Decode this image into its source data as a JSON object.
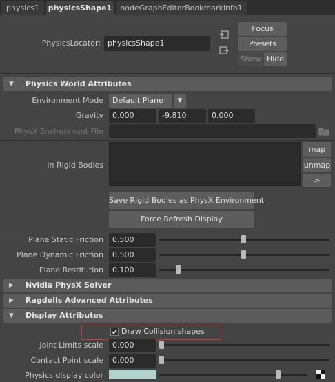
{
  "tabs": [
    "physics1",
    "physicsShape1",
    "nodeGraphEditorBookmarkInfo1"
  ],
  "locator": {
    "label": "PhysicsLocator:",
    "value": "physicsShape1",
    "focus": "Focus",
    "presets": "Presets",
    "show": "Show",
    "hide": "Hide"
  },
  "world": {
    "title": "Physics World Attributes",
    "env_mode_label": "Environment Mode",
    "env_mode_value": "Default Plane",
    "gravity_label": "Gravity",
    "gravity": [
      "0.000",
      "-9.810",
      "0.000"
    ],
    "physx_file_label": "PhysX Environment File",
    "rigid_label": "In Rigid Bodies",
    "map": "map",
    "unmap": "unmap",
    "more": ">",
    "save_env": "Save Rigid Bodies as PhysX Environment",
    "force_refresh": "Force Refresh Display",
    "static_friction_label": "Plane Static Friction",
    "static_friction": "0.500",
    "dynamic_friction_label": "Plane Dynamic Friction",
    "dynamic_friction": "0.500",
    "restitution_label": "Plane Restitution",
    "restitution": "0.100"
  },
  "sections": {
    "solver": "Nvidia PhysX Solver",
    "ragdolls": "Ragdolls Advanced Attributes",
    "display": "Display Attributes"
  },
  "display": {
    "draw_collision_label": "Draw Collision shapes",
    "draw_collision_checked": true,
    "joint_limits_label": "Joint Limits scale",
    "joint_limits": "0.000",
    "contact_point_label": "Contact Point scale",
    "contact_point": "0.000",
    "color_label": "Physics display color",
    "color_swatch": "#b4d2cd"
  },
  "colors": {
    "highlight_box": "#c8393a"
  }
}
